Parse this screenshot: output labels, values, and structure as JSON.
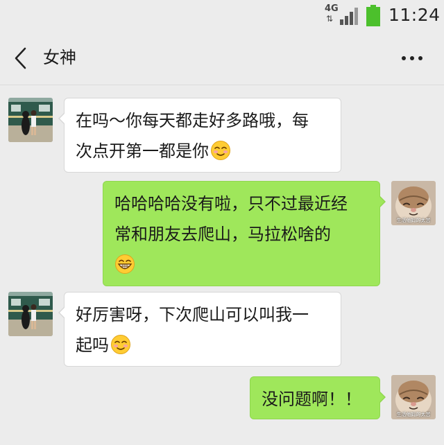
{
  "status_bar": {
    "network": "4G",
    "network_activity": "⇅",
    "time": "11:24",
    "signal_icon": "signal-bars-icon",
    "battery_icon": "battery-icon",
    "battery_color": "#4cc02c"
  },
  "nav": {
    "title": "女神",
    "back_icon": "chevron-left-icon",
    "more_icon": "more-dots-icon"
  },
  "messages": [
    {
      "side": "left",
      "avatar": "contact-avatar",
      "lines": [
        "在吗～你每天都走好多路哦，每",
        "次点开第一都是你"
      ],
      "emoji": "blushing-smile-emoji"
    },
    {
      "side": "right",
      "avatar": "self-avatar",
      "lines": [
        "哈哈哈哈没有啦，只不过最近经",
        "常和朋友去爬山，马拉松啥的"
      ],
      "emoji": "grinning-emoji"
    },
    {
      "side": "left",
      "avatar": "contact-avatar",
      "lines": [
        "好厉害呀，下次爬山可以叫我一",
        "起吗"
      ],
      "emoji": "blushing-smile-emoji"
    },
    {
      "side": "right",
      "avatar": "self-avatar",
      "lines": [
        "没问题啊！！"
      ],
      "emoji": ""
    }
  ],
  "self_avatar_caption": "生活他妈的太苦",
  "colors": {
    "background": "#ececec",
    "bubble_self": "#9fe75b",
    "bubble_other": "#ffffff"
  }
}
